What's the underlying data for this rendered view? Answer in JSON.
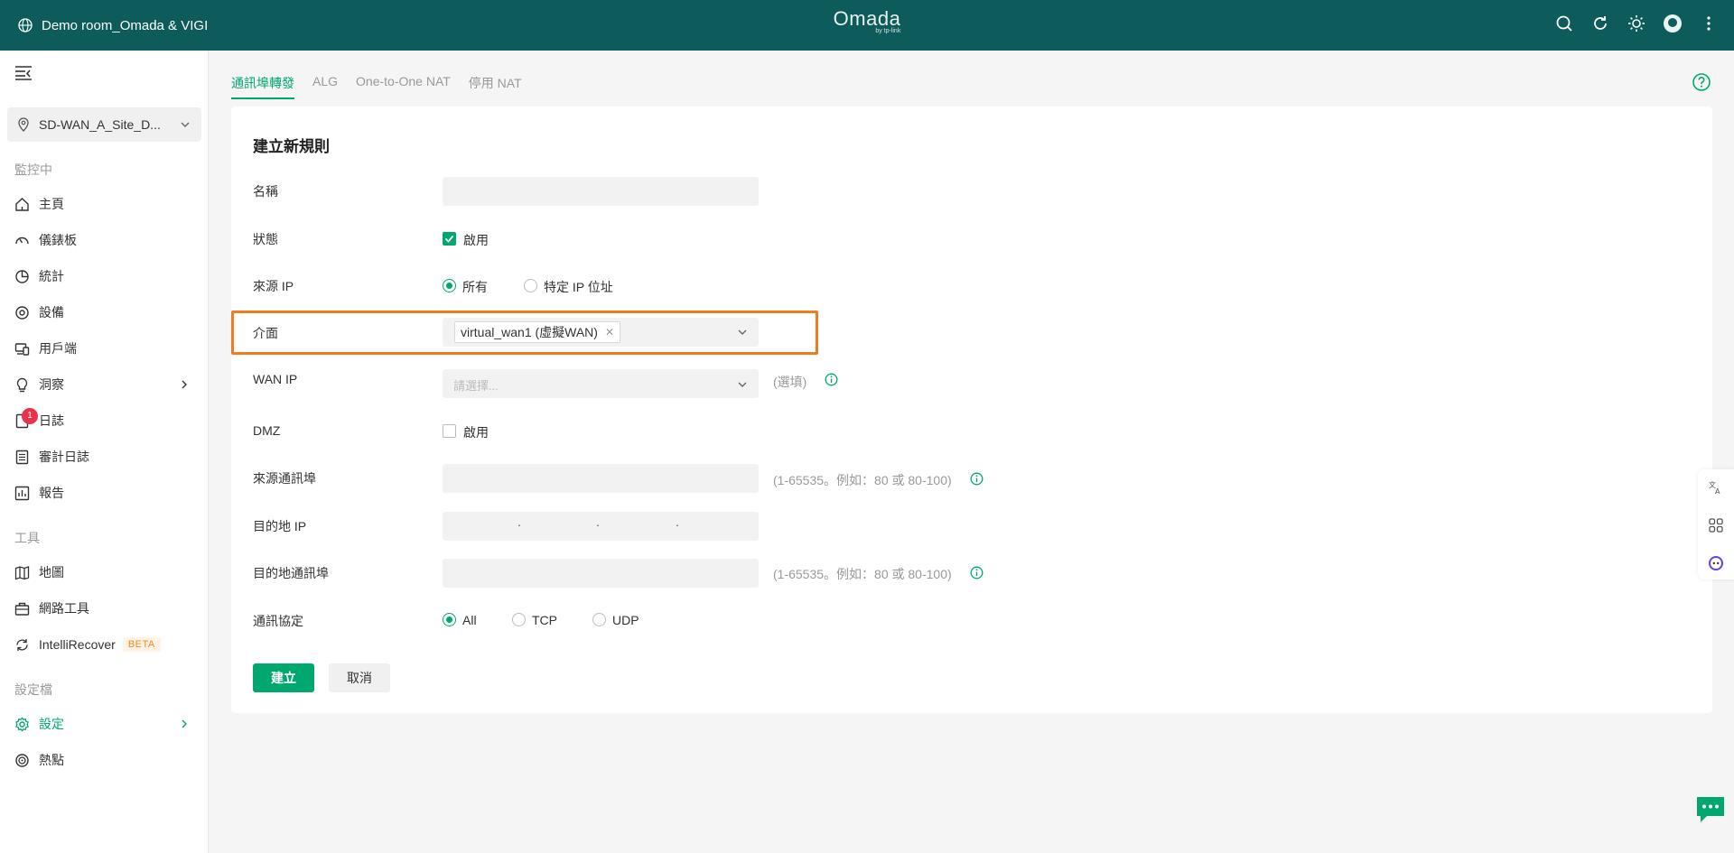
{
  "header": {
    "site_name": "Demo room_Omada & VIGI",
    "logo_main": "Omada",
    "logo_sub": "by tp-link"
  },
  "sidebar": {
    "site_selector": "SD-WAN_A_Site_D...",
    "section_monitoring": "監控中",
    "section_tools": "工具",
    "section_config": "設定檔",
    "items": {
      "home": "主頁",
      "dashboard": "儀錶板",
      "statistics": "統計",
      "devices": "設備",
      "clients": "用戶端",
      "insights": "洞察",
      "logs": "日誌",
      "audit_logs": "審計日誌",
      "reports": "報告",
      "map": "地圖",
      "network_tools": "網路工具",
      "intellirecover": "IntelliRecover",
      "settings": "設定",
      "hotspot": "熱點"
    },
    "logs_badge": "1",
    "beta_badge": "BETA"
  },
  "tabs": {
    "port_forwarding": "通訊埠轉發",
    "alg": "ALG",
    "one_to_one_nat": "One-to-One NAT",
    "disable_nat": "停用 NAT"
  },
  "form": {
    "title": "建立新規則",
    "name_label": "名稱",
    "name_value": "",
    "status_label": "狀態",
    "status_enable": "啟用",
    "source_ip_label": "來源 IP",
    "source_ip_all": "所有",
    "source_ip_specific": "特定 IP 位址",
    "interface_label": "介面",
    "interface_tag": "virtual_wan1 (虛擬WAN)",
    "wan_ip_label": "WAN IP",
    "wan_ip_placeholder": "請選擇...",
    "optional": "(選填)",
    "dmz_label": "DMZ",
    "dmz_enable": "啟用",
    "source_port_label": "來源通訊埠",
    "port_hint": "(1-65535。例如：80 或 80-100)",
    "dest_ip_label": "目的地 IP",
    "dest_port_label": "目的地通訊埠",
    "protocol_label": "通訊協定",
    "protocol_all": "All",
    "protocol_tcp": "TCP",
    "protocol_udp": "UDP",
    "create_button": "建立",
    "cancel_button": "取消"
  },
  "colors": {
    "header_bg": "#0e5b5b",
    "accent": "#00a870",
    "highlight": "#f47a22",
    "badge": "#e9314c"
  }
}
